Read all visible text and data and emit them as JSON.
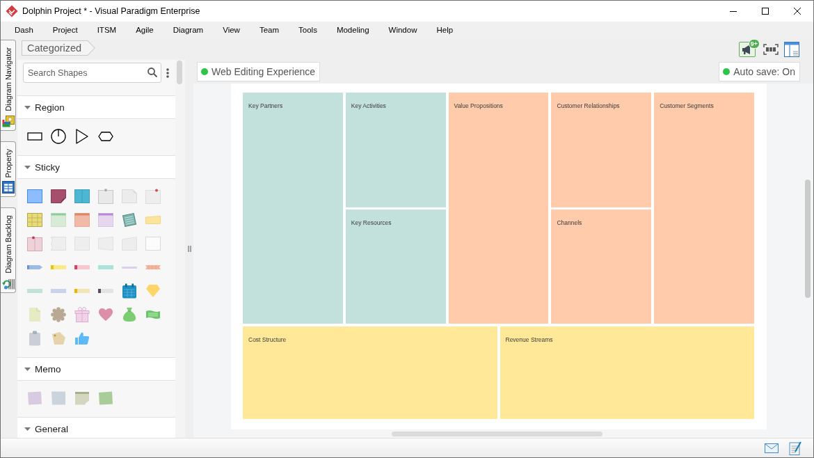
{
  "window": {
    "title": "Dolphin Project * - Visual Paradigm Enterprise"
  },
  "menu": [
    "Dash",
    "Project",
    "ITSM",
    "Agile",
    "Diagram",
    "View",
    "Team",
    "Tools",
    "Modeling",
    "Window",
    "Help"
  ],
  "side_tabs": [
    {
      "label": "Diagram Navigator",
      "kind": "navigator"
    },
    {
      "label": "Property",
      "kind": "property"
    },
    {
      "label": "Diagram Backlog",
      "kind": "backlog"
    }
  ],
  "shape_panel": {
    "breadcrumb": "Categorized",
    "search": {
      "placeholder": "Search Shapes"
    },
    "sections": [
      {
        "title": "Region",
        "kind": "region",
        "expanded": true
      },
      {
        "title": "Sticky",
        "kind": "sticky",
        "expanded": true
      },
      {
        "title": "Memo",
        "kind": "memo",
        "expanded": true
      },
      {
        "title": "General",
        "kind": "general",
        "expanded": true
      }
    ]
  },
  "toolbar": {
    "notification_count": "9+"
  },
  "canvas": {
    "badges": [
      {
        "label": "Web Editing Experience"
      },
      {
        "label": "Auto save: On"
      }
    ],
    "columns": [
      {
        "blocks": [
          {
            "label": "Key Partners",
            "color": "#c2e1dc"
          }
        ]
      },
      {
        "blocks": [
          {
            "label": "Key Activities",
            "color": "#c2e1dc"
          },
          {
            "label": "Key Resources",
            "color": "#c2e1dc"
          }
        ]
      },
      {
        "blocks": [
          {
            "label": "Value Propositions",
            "color": "#ffcbab"
          }
        ]
      },
      {
        "blocks": [
          {
            "label": "Customer Relationships",
            "color": "#ffcbab"
          },
          {
            "label": "Channels",
            "color": "#ffcbab"
          }
        ]
      },
      {
        "blocks": [
          {
            "label": "Customer Segments",
            "color": "#ffcbab"
          }
        ]
      }
    ],
    "bottom_blocks": [
      {
        "label": "Cost Structure",
        "color": "#ffe898"
      },
      {
        "label": "Revenue Streams",
        "color": "#ffe898"
      }
    ]
  }
}
